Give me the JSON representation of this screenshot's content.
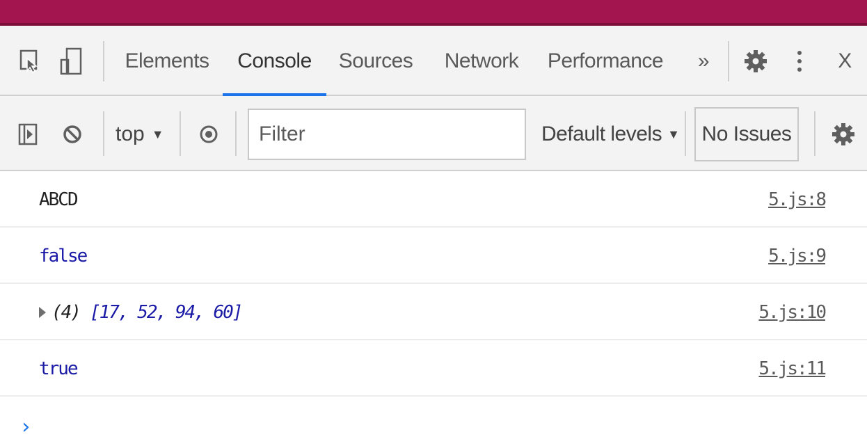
{
  "tabs": {
    "items": [
      {
        "label": "Elements",
        "active": false
      },
      {
        "label": "Console",
        "active": true
      },
      {
        "label": "Sources",
        "active": false
      },
      {
        "label": "Network",
        "active": false
      },
      {
        "label": "Performance",
        "active": false
      }
    ],
    "more_label": "»",
    "close_label": "X",
    "icons": [
      "inspect-element-icon",
      "device-toolbar-icon",
      "settings-gear-icon",
      "more-options-icon",
      "close-icon"
    ]
  },
  "toolbar": {
    "context_label": "top",
    "context_arrow": "▼",
    "filter_placeholder": "Filter",
    "levels_label": "Default levels",
    "levels_arrow": "▼",
    "issues_label": "No Issues",
    "icons": [
      "sidebar-toggle-icon",
      "clear-console-icon",
      "live-expression-eye-icon",
      "console-settings-gear-icon"
    ]
  },
  "console": {
    "rows": [
      {
        "text": "ABCD",
        "source": "5.js:8",
        "kind": "string"
      },
      {
        "text": "false",
        "source": "5.js:9",
        "kind": "value"
      },
      {
        "count": "(4)",
        "text": "[17, 52, 94, 60]",
        "source": "5.js:10",
        "kind": "array"
      },
      {
        "text": "true",
        "source": "5.js:11",
        "kind": "value"
      }
    ],
    "prompt": "›"
  },
  "colors": {
    "title_bar": "#a2154e",
    "accent": "#1a73e8",
    "value_text": "#1a1aa6"
  }
}
